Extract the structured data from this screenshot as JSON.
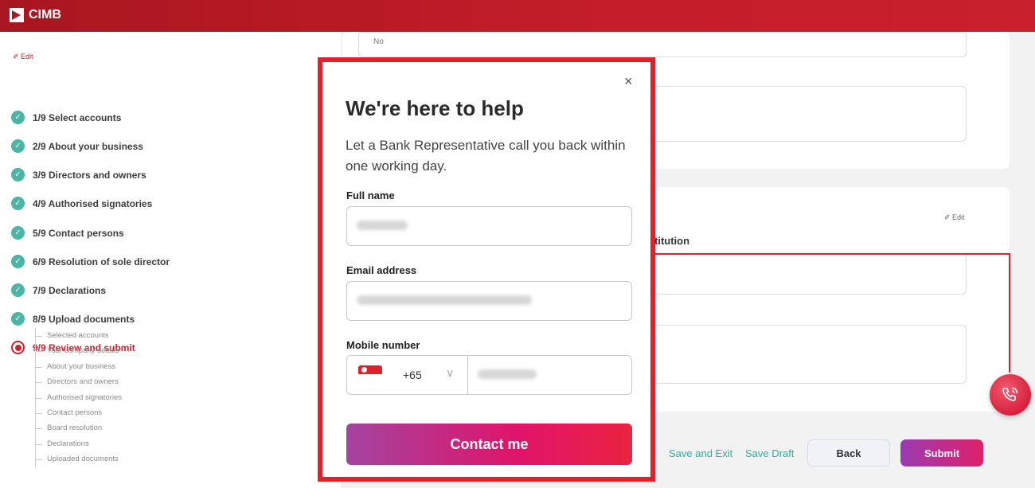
{
  "header": {
    "brand": "CIMB"
  },
  "sidebar": {
    "edit_label": "✐ Edit",
    "steps": [
      {
        "label": "1/9 Select accounts",
        "status": "done"
      },
      {
        "label": "2/9 About your business",
        "status": "done"
      },
      {
        "label": "3/9 Directors and owners",
        "status": "done"
      },
      {
        "label": "4/9 Authorised signatories",
        "status": "done"
      },
      {
        "label": "5/9 Contact persons",
        "status": "done"
      },
      {
        "label": "6/9 Resolution of sole director",
        "status": "done"
      },
      {
        "label": "7/9 Declarations",
        "status": "done"
      },
      {
        "label": "8/9 Upload documents",
        "status": "done"
      },
      {
        "label": "9/9 Review and submit",
        "status": "active"
      }
    ],
    "substeps": [
      "Selected accounts",
      "Your company details",
      "About your business",
      "Directors and owners",
      "Authorised signatories",
      "Contact persons",
      "Board resolution",
      "Declarations",
      "Uploaded documents"
    ]
  },
  "main": {
    "field_no_value": "No",
    "card_edit": "✐ Edit",
    "partial_label": "titution",
    "save_exit": "Save and Exit",
    "save_draft": "Save Draft",
    "back": "Back",
    "submit": "Submit"
  },
  "modal": {
    "close": "×",
    "title": "We're here to help",
    "subtitle": "Let a Bank Representative call you back within one working day.",
    "full_name_label": "Full name",
    "email_label": "Email address",
    "mobile_label": "Mobile number",
    "country_code": "+65",
    "contact_button": "Contact me"
  },
  "fab": {
    "icon": "phone-call-icon"
  },
  "colors": {
    "brand_red": "#c41e2a",
    "teal": "#4bb6a5",
    "highlight": "#e0202a"
  }
}
